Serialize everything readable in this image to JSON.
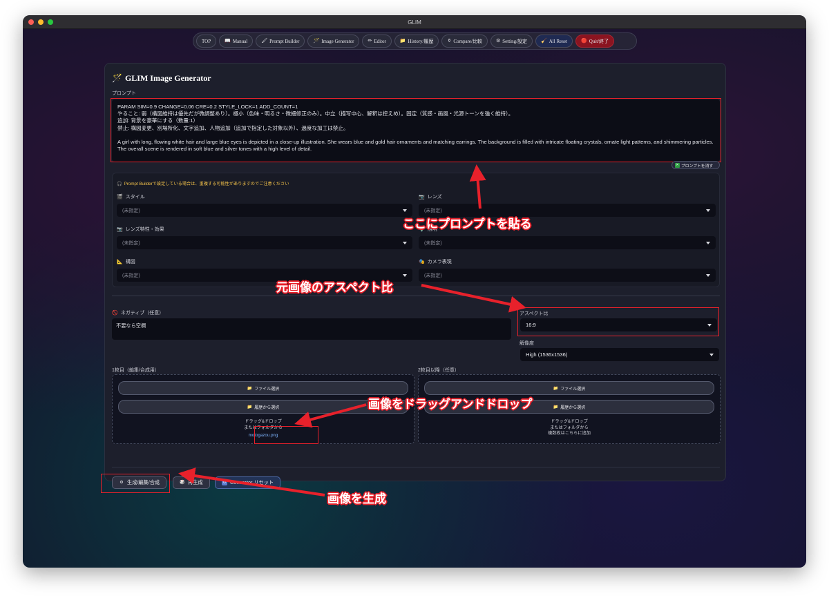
{
  "window": {
    "title": "GLIM"
  },
  "nav": [
    {
      "label": "TOP",
      "icon": ""
    },
    {
      "label": "Manual",
      "icon": "📖"
    },
    {
      "label": "Prompt Builder",
      "icon": "🖌"
    },
    {
      "label": "Image Generator",
      "icon": "🪄"
    },
    {
      "label": "Editor",
      "icon": "✏"
    },
    {
      "label": "History/履歴",
      "icon": "📁"
    },
    {
      "label": "Compare/比較",
      "icon": "⚱"
    },
    {
      "label": "Setting/設定",
      "icon": "⚙"
    },
    {
      "label": "All Reset",
      "icon": "🧹"
    },
    {
      "label": "Quit/終了",
      "icon": "🔴"
    }
  ],
  "page": {
    "title": "GLIM Image Generator",
    "title_icon": "🪄"
  },
  "prompt": {
    "label": "プロンプト",
    "lines": [
      "PARAM SIM=0.9 CHANGE=0.06 CRE=0.2 STYLE_LOCK=1 ADD_COUNT=1",
      "やること: 弱（構図維持は優先だが微調整あり）。極小（色味・明るさ・微細修正のみ）。中立（描写中心、解釈は控えめ）。固定（質感・画風・光源トーンを強く維持）。",
      "追加: 背景を豪華にする（数量:1）",
      "禁止: 構図変更、別場所化、文字追加、人物追加（追加で指定した対象以外）、過度な加工は禁止。",
      "",
      "A girl with long, flowing white hair and large blue eyes is depicted in a close-up illustration. She wears blue and gold hair ornaments and matching earrings. The background is filled with intricate floating crystals, ornate light patterns, and shimmering particles. The overall scene is rendered in soft blue and silver tones with a high level of detail."
    ],
    "clear_label": "プロンプトを消す"
  },
  "builder": {
    "warning": "Prompt Builderで設定している場合は、重複する可能性がありますのでご注意ください",
    "fields": [
      {
        "label": "スタイル",
        "icon": "🎬",
        "value": "(未指定)"
      },
      {
        "label": "レンズ",
        "icon": "📷",
        "value": "(未指定)"
      },
      {
        "label": "レンズ特性・効果",
        "icon": "📷",
        "value": "(未指定)"
      },
      {
        "label": "照明",
        "icon": "💡",
        "value": "(未指定)"
      },
      {
        "label": "構図",
        "icon": "📐",
        "value": "(未指定)"
      },
      {
        "label": "カメラ表現",
        "icon": "🎭",
        "value": "(未指定)"
      }
    ]
  },
  "negative": {
    "label": "ネガティブ（任意）",
    "placeholder": "不要なら空欄"
  },
  "aspect": {
    "label": "アスペクト比",
    "value": "16:9"
  },
  "resolution": {
    "label": "解像度",
    "value": "High (1536x1536)"
  },
  "upload1": {
    "label": "1枚目（編集/合成用）",
    "file_button": "ファイル選択",
    "history_button": "履歴から選択",
    "drop_line1": "ドラッグ&ドロップ",
    "drop_line2": "またはフォルダから",
    "filename": "motogazou.png"
  },
  "upload2": {
    "label": "2枚目以降（任意）",
    "file_button": "ファイル選択",
    "history_button": "履歴から選択",
    "drop_line1": "ドラッグ&ドロップ",
    "drop_line2": "またはフォルダから",
    "drop_line3": "複数枚はこちらに追加"
  },
  "actions": {
    "generate": "生成/編集/合成",
    "regenerate": "再生成",
    "reset": "Generator リセット"
  },
  "annotations": {
    "paste": "ここにプロンプトを貼る",
    "aspect": "元画像のアスペクト比",
    "drag": "画像をドラッグアンドドロップ",
    "generate": "画像を生成"
  },
  "colors": {
    "accent_red": "#e8212b",
    "link_blue": "#7fb6ff",
    "warning_yellow": "#f3c24a"
  }
}
